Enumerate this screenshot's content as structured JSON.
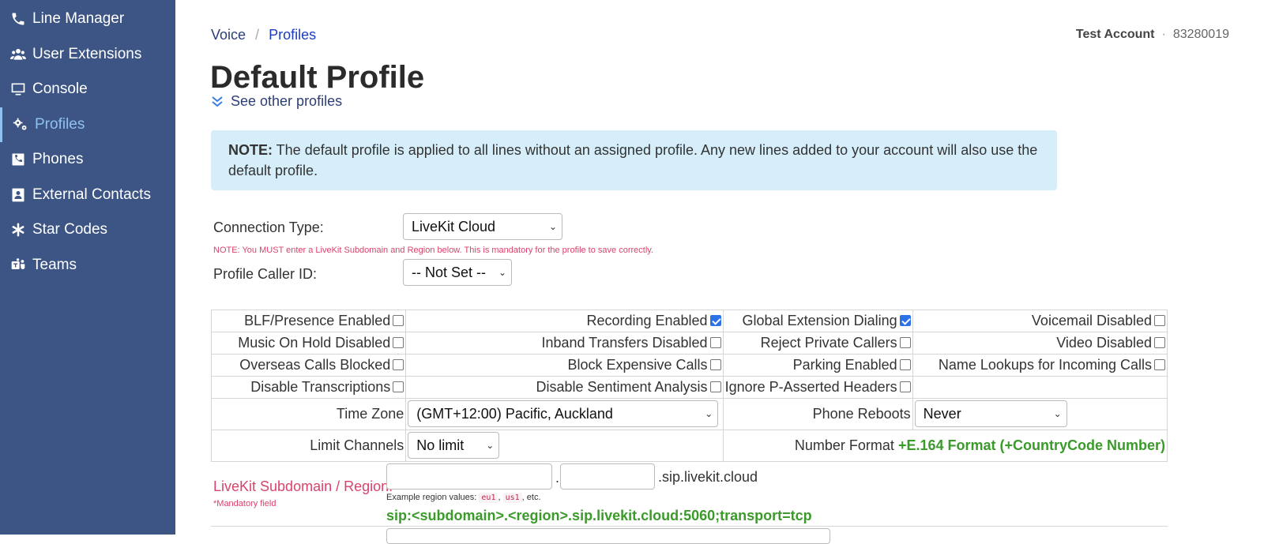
{
  "sidebar": {
    "items": [
      {
        "label": "Line Manager",
        "icon": "phone-icon"
      },
      {
        "label": "User Extensions",
        "icon": "users-icon"
      },
      {
        "label": "Console",
        "icon": "monitor-icon"
      },
      {
        "label": "Profiles",
        "icon": "gears-icon",
        "active": true
      },
      {
        "label": "Phones",
        "icon": "phone-square-icon"
      },
      {
        "label": "External Contacts",
        "icon": "contact-card-icon"
      },
      {
        "label": "Star Codes",
        "icon": "asterisk-icon"
      },
      {
        "label": "Teams",
        "icon": "teams-icon"
      }
    ]
  },
  "breadcrumb": {
    "voice": "Voice",
    "sep": "/",
    "profiles": "Profiles"
  },
  "account": {
    "name": "Test Account",
    "dot": "·",
    "number": "83280019"
  },
  "page": {
    "title": "Default Profile",
    "see_other": "See other profiles"
  },
  "note": {
    "bold": "NOTE:",
    "text": " The default profile is applied to all lines without an assigned profile. Any new lines added to your account will also use the default profile."
  },
  "connection": {
    "label": "Connection Type:",
    "value": "LiveKit Cloud"
  },
  "warning": "NOTE: You MUST enter a LiveKit Subdomain and Region below. This is mandatory for the profile to save correctly.",
  "caller_id": {
    "label": "Profile Caller ID:",
    "value": "-- Not Set --"
  },
  "options": [
    [
      {
        "label": "BLF/Presence Enabled",
        "checked": false
      },
      {
        "label": "Recording Enabled",
        "checked": true
      },
      {
        "label": "Global Extension Dialing",
        "checked": true
      },
      {
        "label": "Voicemail Disabled",
        "checked": false
      }
    ],
    [
      {
        "label": "Music On Hold Disabled",
        "checked": false
      },
      {
        "label": "Inband Transfers Disabled",
        "checked": false
      },
      {
        "label": "Reject Private Callers",
        "checked": false
      },
      {
        "label": "Video Disabled",
        "checked": false
      }
    ],
    [
      {
        "label": "Overseas Calls Blocked",
        "checked": false
      },
      {
        "label": "Block Expensive Calls",
        "checked": false
      },
      {
        "label": "Parking Enabled",
        "checked": false
      },
      {
        "label": "Name Lookups for Incoming Calls",
        "checked": false
      }
    ],
    [
      {
        "label": "Disable Transcriptions",
        "checked": false
      },
      {
        "label": "Disable Sentiment Analysis",
        "checked": false
      },
      {
        "label": "Ignore P-Asserted Headers",
        "checked": false
      }
    ]
  ],
  "timezone": {
    "label": "Time Zone",
    "value": "(GMT+12:00) Pacific, Auckland"
  },
  "reboots": {
    "label": "Phone Reboots",
    "value": "Never"
  },
  "channels": {
    "label": "Limit Channels",
    "value": "No limit"
  },
  "number_format": {
    "label": "Number Format",
    "value": "+E.164 Format (+CountryCode Number)"
  },
  "livekit": {
    "label": "LiveKit Subdomain / Region:",
    "mandatory": "*Mandatory field",
    "dot": ".",
    "suffix": ".sip.livekit.cloud",
    "example_prefix": "Example region values:",
    "example_1": "eu1",
    "example_sep": ",",
    "example_2": "us1",
    "example_suffix": ", etc.",
    "sip_uri": "sip:<subdomain>.<region>.sip.livekit.cloud:5060;transport=tcp"
  },
  "colors": {
    "sidebar": "#3d5585",
    "accent": "#1a3dbf",
    "note_bg": "#d5eefa",
    "warn": "#d9436b",
    "green": "#3a9a2a"
  }
}
